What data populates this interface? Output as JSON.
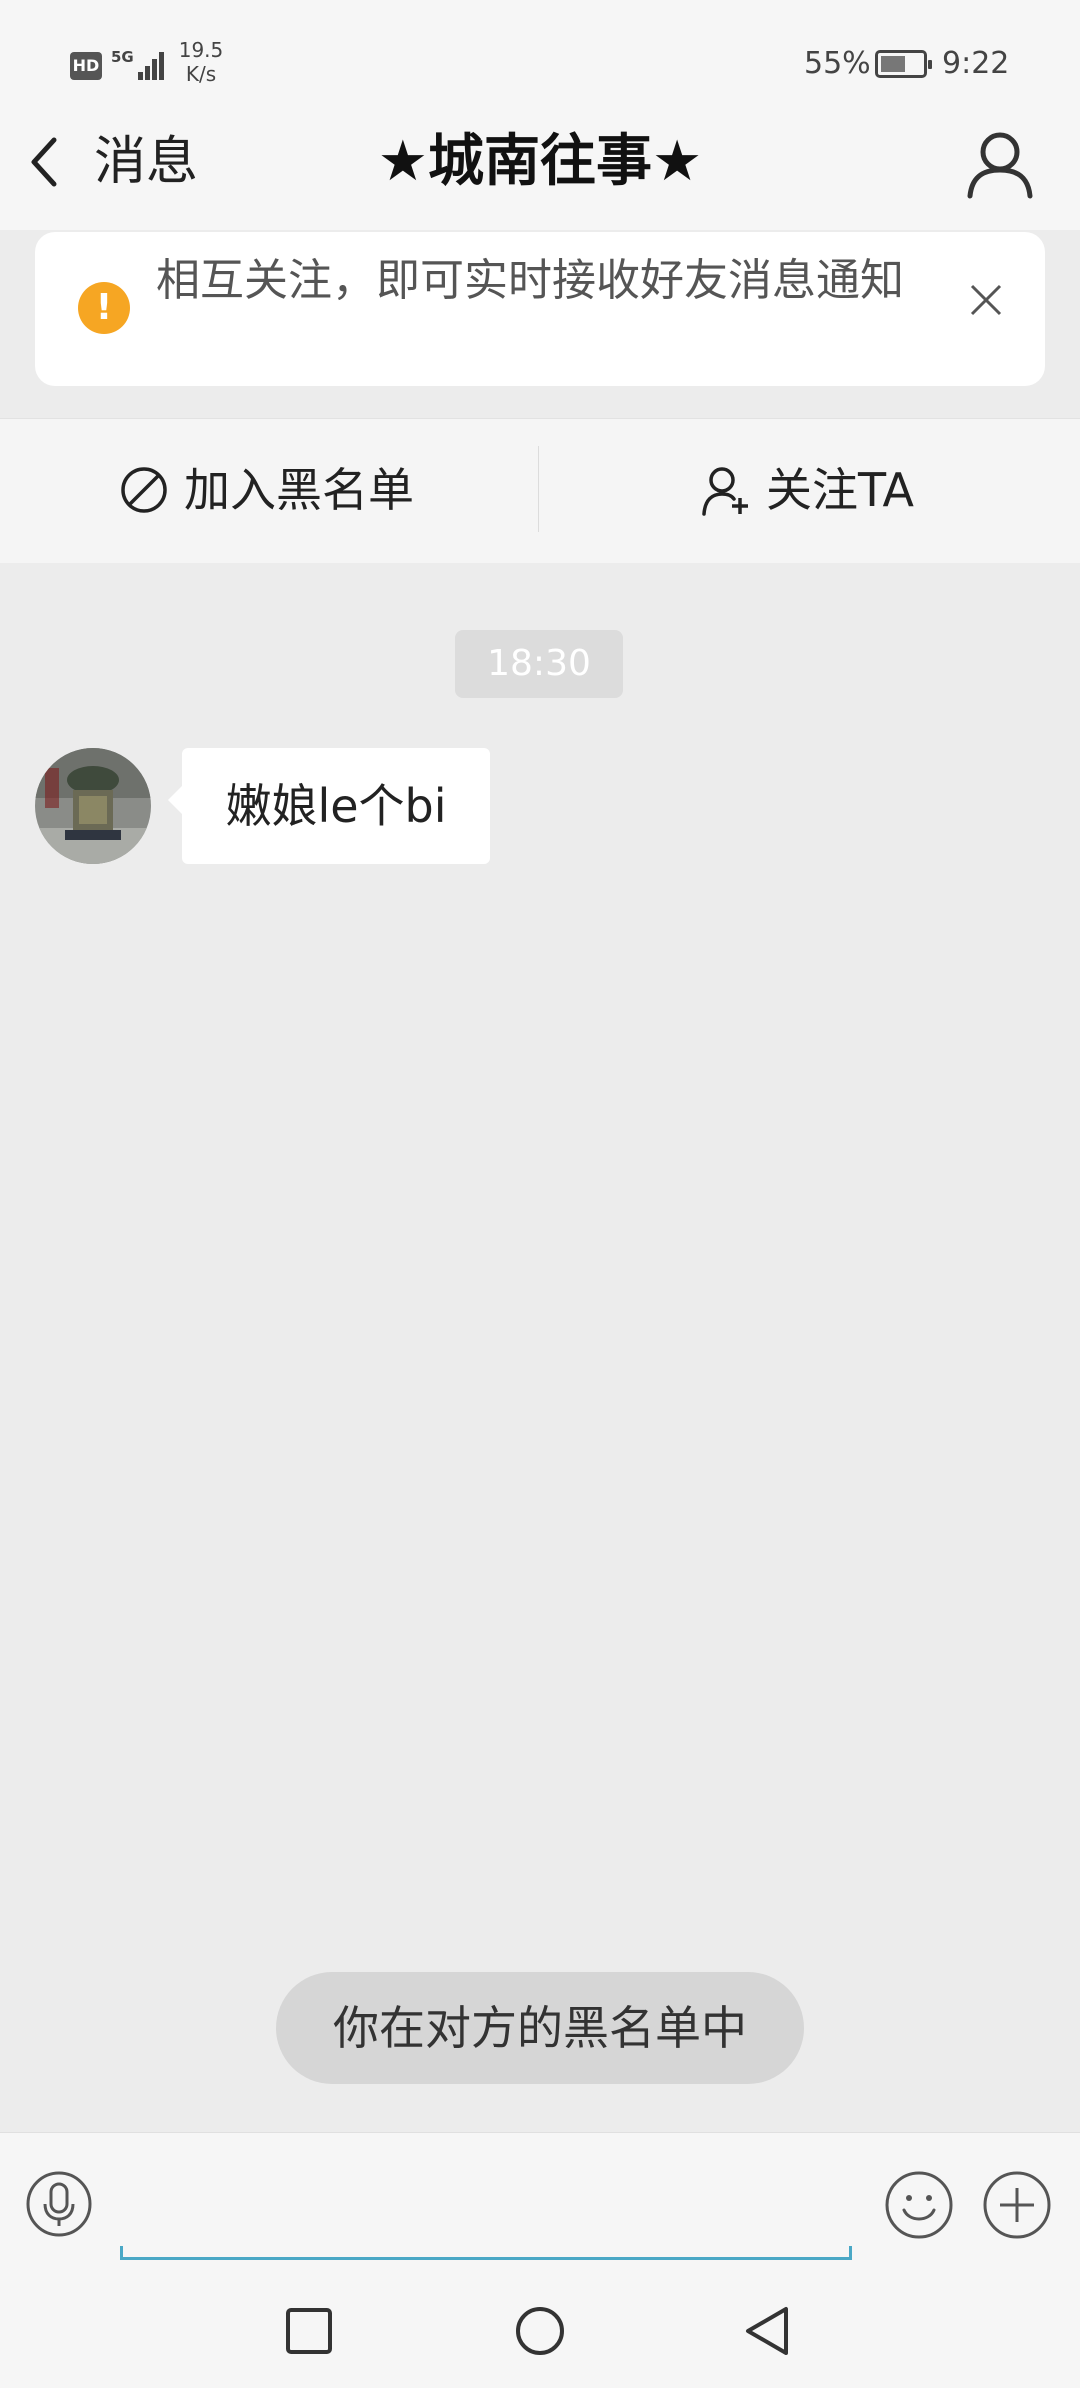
{
  "status_bar": {
    "hd": "HD",
    "network": "5G",
    "speed_value": "19.5",
    "speed_unit": "K/s",
    "battery_percent": "55%",
    "time": "9:22"
  },
  "nav": {
    "back_label": "消息",
    "title": "★城南往事★"
  },
  "notice": {
    "text": "相互关注，即可实时接收好友消息通知"
  },
  "actions": {
    "block_label": "加入黑名单",
    "follow_label": "关注TA"
  },
  "chat": {
    "timestamp": "18:30",
    "messages": [
      {
        "sender": "other",
        "text": "嫩娘le个bi"
      }
    ]
  },
  "toast": "你在对方的黑名单中",
  "input": {
    "placeholder": "",
    "value": ""
  },
  "icons": {
    "back": "chevron-left-icon",
    "profile": "person-icon",
    "warning": "exclamation-circle-icon",
    "close": "close-icon",
    "block": "block-icon",
    "follow": "add-user-icon",
    "mic": "microphone-icon",
    "emoji": "smile-icon",
    "plus": "plus-icon"
  },
  "colors": {
    "warning": "#f6a623",
    "input_underline": "#4aa8c6",
    "chat_background": "#ececec"
  }
}
